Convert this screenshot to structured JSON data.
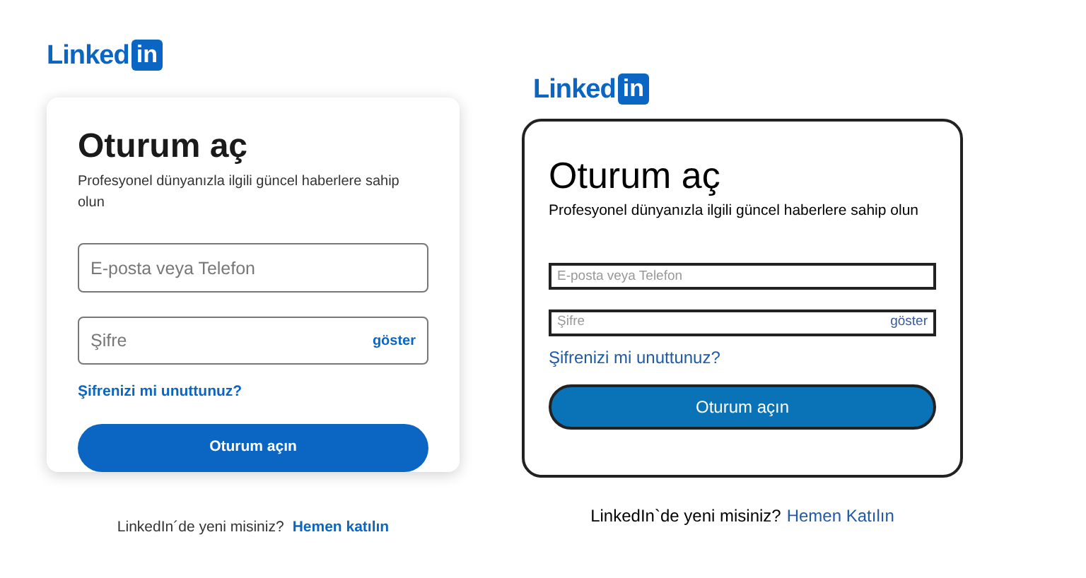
{
  "panels": [
    {
      "kind": "web",
      "logo": {
        "word": "Linked",
        "box": "in"
      },
      "title": "Oturum aç",
      "subtitle": "Profesyonel dünyanızla ilgili güncel haberlere sahip olun",
      "email_field": {
        "placeholder": "E-posta veya Telefon"
      },
      "password_field": {
        "placeholder": "Şifre",
        "toggle": "göster"
      },
      "forgot_link": "Şifrenizi mi unuttunuz?",
      "submit_button": "Oturum açın",
      "footer": {
        "text": "LinkedIn´de yeni misiniz?",
        "link": "Hemen katılın"
      }
    },
    {
      "kind": "sketch",
      "logo": {
        "word": "Linked",
        "box": "in"
      },
      "title": "Oturum aç",
      "subtitle": "Profesyonel dünyanızla ilgili güncel haberlere sahip olun",
      "email_field": {
        "placeholder": "E-posta veya Telefon"
      },
      "password_field": {
        "placeholder": "Şifre",
        "toggle": "göster"
      },
      "forgot_link": "Şifrenizi mi unuttunuz?",
      "submit_button": "Oturum açın",
      "footer": {
        "text": "LinkedIn`de yeni misiniz?",
        "link": "Hemen Katılın"
      }
    }
  ]
}
